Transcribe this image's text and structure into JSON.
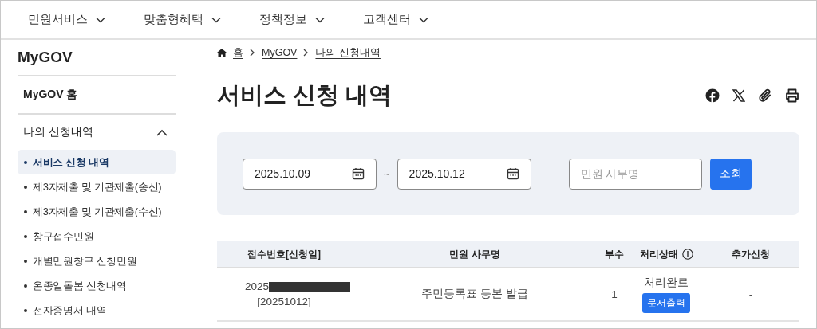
{
  "nav": [
    {
      "label": "민원서비스"
    },
    {
      "label": "맞춤형혜택"
    },
    {
      "label": "정책정보"
    },
    {
      "label": "고객센터"
    }
  ],
  "sidebar": {
    "title": "MyGOV",
    "home": "MyGOV 홈",
    "section": {
      "label": "나의 신청내역",
      "expanded": true,
      "children": [
        {
          "label": "서비스 신청 내역",
          "selected": true
        },
        {
          "label": "제3자제출 및 기관제출(송신)",
          "selected": false
        },
        {
          "label": "제3자제출 및 기관제출(수신)",
          "selected": false
        },
        {
          "label": "창구접수민원",
          "selected": false
        },
        {
          "label": "개별민원창구 신청민원",
          "selected": false
        },
        {
          "label": "온종일돌봄 신청내역",
          "selected": false
        },
        {
          "label": "전자증명서 내역",
          "selected": false
        }
      ]
    }
  },
  "breadcrumb": [
    "홈",
    "MyGOV",
    "나의 신청내역"
  ],
  "page_title": "서비스 신청 내역",
  "filter": {
    "start_date": "2025.10.09",
    "separator": "~",
    "end_date": "2025.10.12",
    "name_placeholder": "민원 사무명",
    "search_button": "조회"
  },
  "table": {
    "columns": [
      {
        "label": "접수번호[신청일]",
        "info": false
      },
      {
        "label": "민원 사무명",
        "info": false
      },
      {
        "label": "부수",
        "info": false
      },
      {
        "label": "처리상태",
        "info": true
      },
      {
        "label": "추가신청",
        "info": false
      }
    ],
    "rows": [
      {
        "receipt_prefix": "2025",
        "redacted": true,
        "date": "[20251012]",
        "name": "주민등록표 등본 발급",
        "copies": "1",
        "status": "처리완료",
        "action": "문서출력",
        "extra": "-"
      }
    ]
  }
}
